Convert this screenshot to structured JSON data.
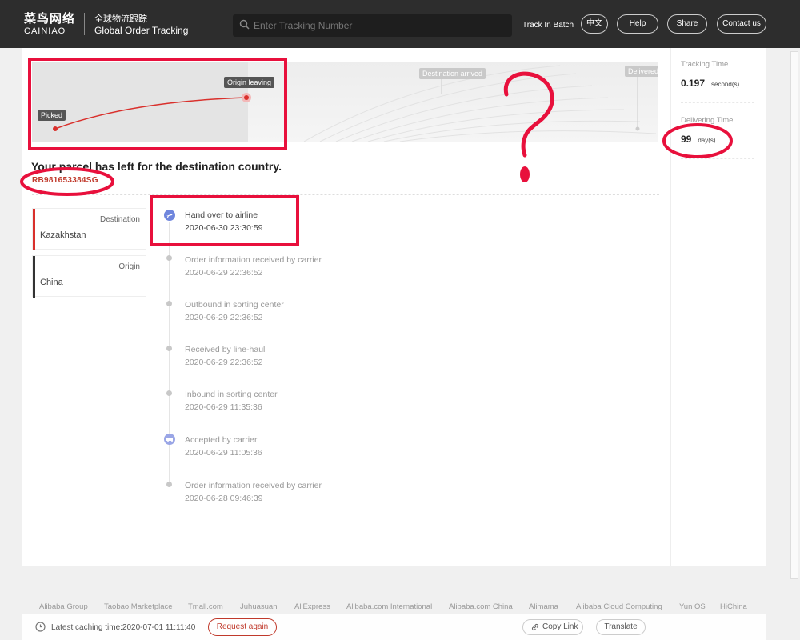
{
  "header": {
    "logo_cn": "菜鸟网络",
    "logo_en": "CAINIAO",
    "subtitle_cn": "全球物流跟踪",
    "subtitle_en": "Global Order Tracking",
    "search_placeholder": "Enter Tracking Number",
    "batch_label": "Track In Batch",
    "buttons": {
      "lang": "中文",
      "help": "Help",
      "share": "Share",
      "contact": "Contact us"
    }
  },
  "map": {
    "picked": "Picked",
    "origin_leaving": "Origin leaving",
    "destination_arrived": "Destination arrived",
    "delivered": "Delivered"
  },
  "parcel": {
    "status": "Your parcel has left for the destination country.",
    "tracking_number": "RB981653384SG"
  },
  "locations": {
    "destination_label": "Destination",
    "destination_name": "Kazakhstan",
    "origin_label": "Origin",
    "origin_name": "China"
  },
  "events": [
    {
      "title": "Hand over to airline",
      "time": "2020-06-30 23:30:59",
      "icon": "airplane-icon"
    },
    {
      "title": "Order information received by carrier",
      "time": "2020-06-29 22:36:52",
      "icon": "dot"
    },
    {
      "title": "Outbound in sorting center",
      "time": "2020-06-29 22:36:52",
      "icon": "dot"
    },
    {
      "title": "Received by line-haul",
      "time": "2020-06-29 22:36:52",
      "icon": "dot"
    },
    {
      "title": "Inbound in sorting center",
      "time": "2020-06-29 11:35:36",
      "icon": "dot"
    },
    {
      "title": "Accepted by carrier",
      "time": "2020-06-29 11:05:36",
      "icon": "truck-icon"
    },
    {
      "title": "Order information received by carrier",
      "time": "2020-06-28 09:46:39",
      "icon": "dot"
    }
  ],
  "side": {
    "tracking_time_label": "Tracking Time",
    "tracking_time_value": "0.197",
    "tracking_time_unit": "second(s)",
    "delivering_time_label": "Delivering Time",
    "delivering_time_value": "99",
    "delivering_time_unit": "day(s)"
  },
  "footer": {
    "links": [
      "Alibaba Group",
      "Taobao Marketplace",
      "Tmall.com",
      "Juhuasuan",
      "AliExpress",
      "Alibaba.com International",
      "Alibaba.com China",
      "Alimama",
      "Alibaba Cloud Computing",
      "Yun OS",
      "HiChina"
    ],
    "cache_text": "Latest caching time:2020-07-01 11:11:40",
    "request_again": "Request again",
    "copy_link": "Copy Link",
    "translate": "Translate"
  },
  "colors": {
    "accent": "#c0392b",
    "annotation": "#e8103c",
    "header_bg": "#2d2d2d",
    "timeline_icon": "#7b8fe0"
  }
}
